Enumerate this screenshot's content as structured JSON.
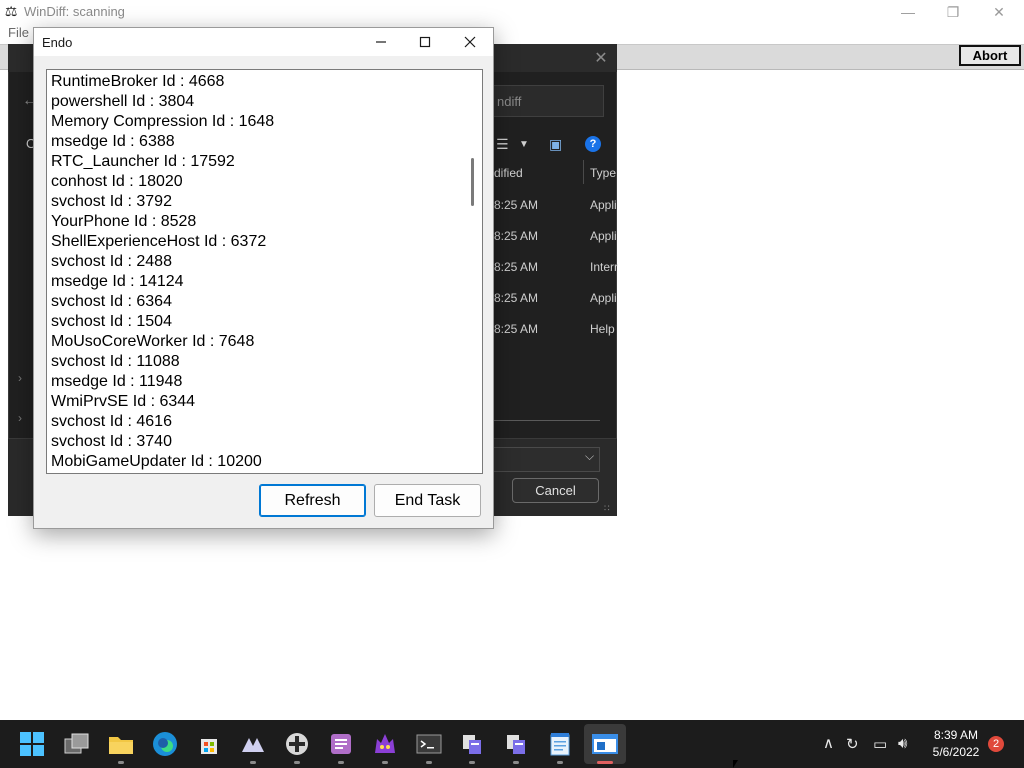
{
  "windiff": {
    "title": "WinDiff: scanning",
    "menu_file": "File",
    "abort_label": "Abort",
    "minimize_glyph": "—",
    "restore_glyph": "❐",
    "close_glyph": "✕"
  },
  "file_dialog": {
    "search_placeholder": "ndiff",
    "col_modified": "dified",
    "col_type": "Type",
    "rows": [
      {
        "time": "8:25 AM",
        "type": "Appli"
      },
      {
        "time": "8:25 AM",
        "type": "Appli"
      },
      {
        "time": "8:25 AM",
        "type": "Interr"
      },
      {
        "time": "8:25 AM",
        "type": "Appli"
      },
      {
        "time": "8:25 AM",
        "type": "Help"
      }
    ],
    "cancel_label": "Cancel",
    "left_cut_text": "O"
  },
  "endo": {
    "title": "Endo",
    "processes": [
      "RuntimeBroker Id : 4668",
      "powershell Id : 3804",
      "Memory Compression Id : 1648",
      "msedge Id : 6388",
      "RTC_Launcher Id : 17592",
      "conhost Id : 18020",
      "svchost Id : 3792",
      "YourPhone Id : 8528",
      "ShellExperienceHost Id : 6372",
      "svchost Id : 2488",
      "msedge Id : 14124",
      "svchost Id : 6364",
      "svchost Id : 1504",
      "MoUsoCoreWorker Id : 7648",
      "svchost Id : 11088",
      "msedge Id : 11948",
      "WmiPrvSE Id : 6344",
      "svchost Id : 4616",
      "svchost Id : 3740",
      "MobiGameUpdater Id : 10200"
    ],
    "refresh_label": "Refresh",
    "end_task_label": "End Task"
  },
  "taskbar": {
    "clock_time": "8:39 AM",
    "clock_date": "5/6/2022",
    "notification_count": "2"
  },
  "colors": {
    "accent": "#0078d4",
    "taskbar_bg": "#1c1c1c",
    "dialog_dark_bg": "#202020",
    "notification_badge": "#e0493b"
  }
}
